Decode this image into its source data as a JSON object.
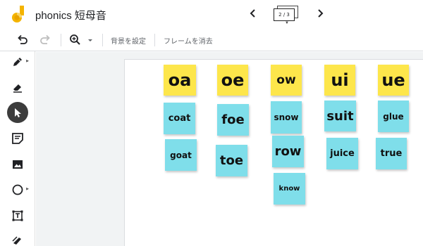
{
  "app": {
    "title": "phonics 短母音",
    "frame_indicator": "2 / 3",
    "prev_icon": "chevron-left-icon",
    "next_icon": "chevron-right-icon"
  },
  "toolbar": {
    "set_background_label": "背景を設定",
    "clear_frame_label": "フレームを消去"
  },
  "notes": [
    {
      "text": "oa",
      "color": "yellow"
    },
    {
      "text": "oe",
      "color": "yellow"
    },
    {
      "text": "ow",
      "color": "yellow"
    },
    {
      "text": "ui",
      "color": "yellow"
    },
    {
      "text": "ue",
      "color": "yellow"
    },
    {
      "text": "coat",
      "color": "blue"
    },
    {
      "text": "foe",
      "color": "blue"
    },
    {
      "text": "snow",
      "color": "blue"
    },
    {
      "text": "suit",
      "color": "blue"
    },
    {
      "text": "glue",
      "color": "blue"
    },
    {
      "text": "goat",
      "color": "blue"
    },
    {
      "text": "toe",
      "color": "blue"
    },
    {
      "text": "row",
      "color": "blue"
    },
    {
      "text": "juice",
      "color": "blue"
    },
    {
      "text": "true",
      "color": "blue"
    },
    {
      "text": "know",
      "color": "blue"
    }
  ],
  "colors": {
    "yellow_note": "#fde64b",
    "blue_note": "#7fdeea",
    "active_tool": "#3c3c3c",
    "canvas_background": "#f1f3f4"
  }
}
